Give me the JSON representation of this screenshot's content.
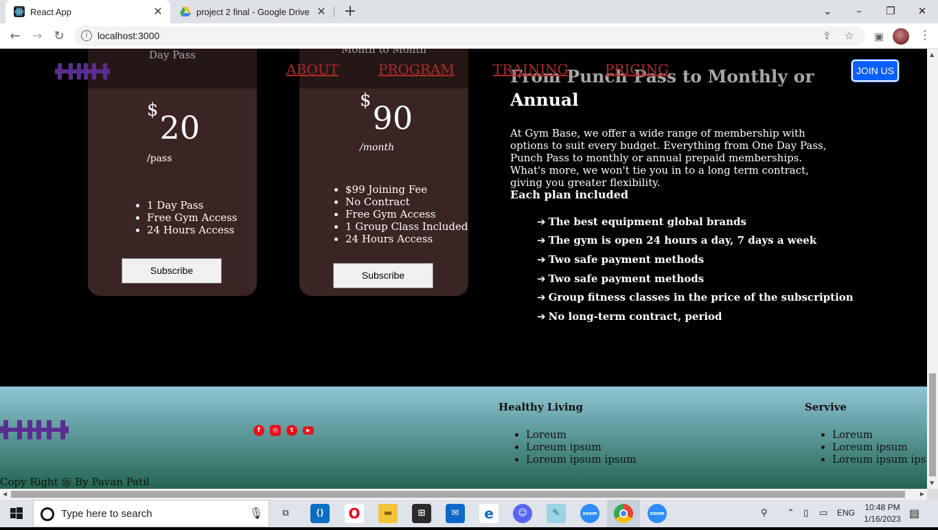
{
  "browser": {
    "tabs": [
      {
        "title": "React App",
        "active": true
      },
      {
        "title": "project 2 final - Google Drive",
        "active": false
      }
    ],
    "url": "localhost:3000"
  },
  "site": {
    "nav": {
      "links": [
        "ABOUT",
        "PROGRAM",
        "TRAINING",
        "PRICING"
      ],
      "join_label": "JOIN US",
      "link_color": "#b12a2a"
    },
    "plans": [
      {
        "title": "Day Pass",
        "currency": "$",
        "price": "20",
        "period": "/pass",
        "features": [
          "1 Day Pass",
          "Free Gym Access",
          "24 Hours Access"
        ],
        "button": "Subscribe"
      },
      {
        "title": "Month to Month",
        "currency": "$",
        "price": "90",
        "period": "/month",
        "features": [
          "$99 Joining Fee",
          "No Contract",
          "Free Gym Access",
          "1 Group Class Included",
          "24 Hours Access"
        ],
        "button": "Subscribe"
      }
    ],
    "info": {
      "headline": "From Punch Pass to Monthly or Annual",
      "description": "At Gym Base, we offer a wide range of membership with options to suit every budget. Everything from One Day Pass, Punch Pass to monthly or annual prepaid memberships. What's more, we won't tie you in to a long term contract, giving you greater flexibility.",
      "plan_heading": "Each plan included",
      "features": [
        "The best equipment global brands",
        "The gym is open 24 hours a day, 7 days a week",
        "Two safe payment methods",
        "Two safe payment methods",
        "Group fitness classes in the price of the subscription",
        "No long-term contract, period"
      ]
    },
    "footer": {
      "social_icons": [
        "facebook-icon",
        "instagram-icon",
        "twitter-icon",
        "youtube-icon"
      ],
      "columns": [
        {
          "heading": "Healthy Living",
          "items": [
            "Loreum",
            "Loreum ipsum",
            "Loreum ipsum ipsum"
          ]
        },
        {
          "heading": "Servive",
          "items": [
            "Loreum",
            "Loreum ipsum",
            "Loreum ipsum ipsum"
          ]
        }
      ],
      "copyright": "Copy Right @ By Pavan Patil"
    }
  },
  "taskbar": {
    "search_placeholder": "Type here to search",
    "language": "ENG",
    "time": "10:48 PM",
    "date": "1/16/2023"
  },
  "colors": {
    "card_bg": "#3b2424",
    "logo": "#5b2d91",
    "join_button": "#0b5fff",
    "social": "#e4141b"
  }
}
